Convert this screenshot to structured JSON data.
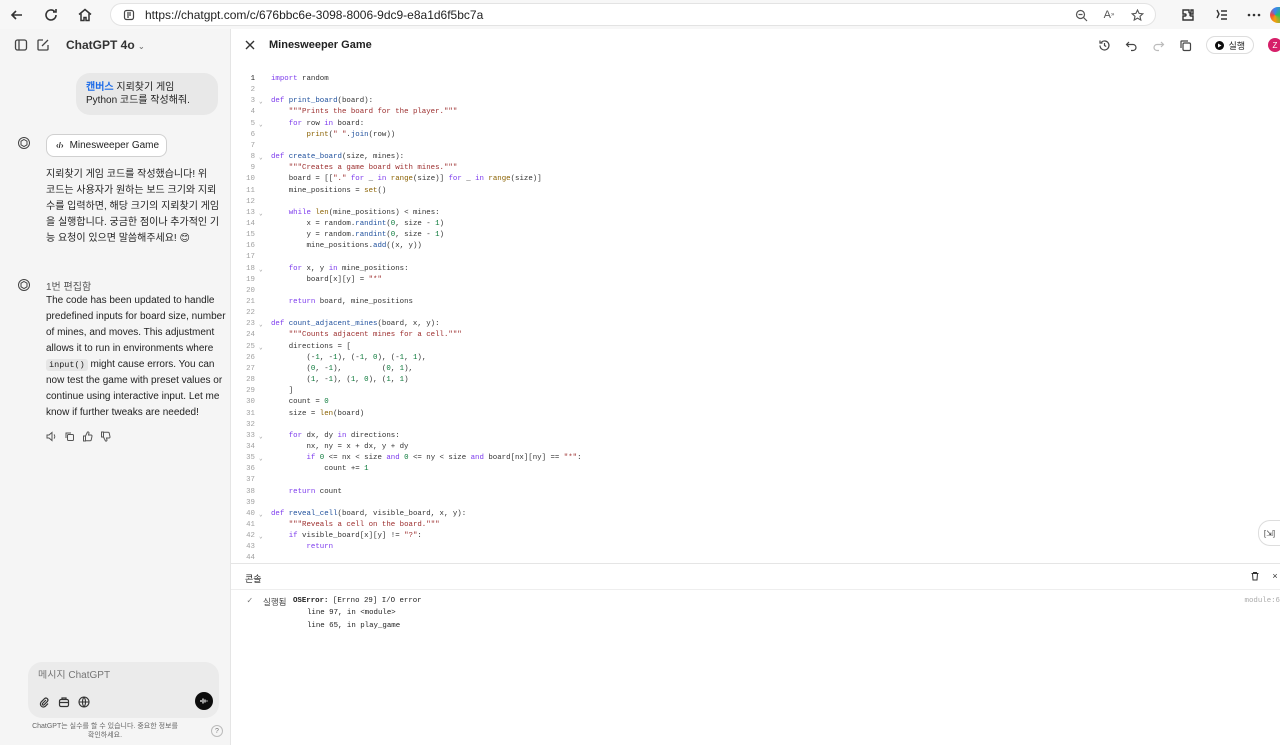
{
  "browser": {
    "url": "https://chatgpt.com/c/676bbc6e-3098-8006-9dc9-e8a1d6f5bc7a",
    "icons": [
      "back-icon",
      "reload-icon",
      "home-icon",
      "site-info-icon",
      "zoom-icon",
      "read-aloud-icon",
      "favorite-icon",
      "extensions-icon",
      "collections-icon",
      "more-icon"
    ]
  },
  "chat": {
    "model": "ChatGPT 4o",
    "user_prefix": "캔버스",
    "user_message": " 지뢰찾기 게임 Python 코드를 작성해줘.",
    "canvas_chip": "Minesweeper Game",
    "reply_lines": [
      "지뢰찾기 게임 코드를 작성했습니다! 위",
      "코드는 사용자가 원하는 보드 크기와 지뢰",
      "수를 입력하면, 해당 크기의 지뢰찾기 게임",
      "을 실행합니다. 궁금한 점이나 추가적인 기",
      "능 요청이 있으면 말씀해주세요! 😊"
    ],
    "edit_label": "1번 편집함",
    "update_lines_1": [
      "The code has been updated to handle",
      "predefined inputs for board size, number",
      "of mines, and moves. This adjustment",
      "allows it to run in environments where"
    ],
    "inline_code": "input()",
    "update_after_code": " might cause errors. You can",
    "update_lines_2": [
      "now test the game with preset values or",
      "continue using interactive input. Let me",
      "know if further tweaks are needed!"
    ],
    "composer_placeholder": "메시지 ChatGPT",
    "footer_line1": "ChatGPT는 실수를 할 수 있습니다. 중요한 정보를",
    "footer_line2": "확인하세요.",
    "help": "?"
  },
  "canvas": {
    "title": "Minesweeper Game",
    "run_label": "실행",
    "avatar_letter": "Z",
    "side_tab": "[⇲]",
    "code_lines": [
      {
        "n": "1",
        "t": "import random"
      },
      {
        "n": "2",
        "t": ""
      },
      {
        "n": "3",
        "t": "def print_board(board):",
        "fold": true
      },
      {
        "n": "4",
        "t": "    \"\"\"Prints the board for the player.\"\"\""
      },
      {
        "n": "5",
        "t": "    for row in board:",
        "fold": true
      },
      {
        "n": "6",
        "t": "        print(\" \".join(row))"
      },
      {
        "n": "7",
        "t": ""
      },
      {
        "n": "8",
        "t": "def create_board(size, mines):",
        "fold": true
      },
      {
        "n": "9",
        "t": "    \"\"\"Creates a game board with mines.\"\"\""
      },
      {
        "n": "10",
        "t": "    board = [[\".\" for _ in range(size)] for _ in range(size)]"
      },
      {
        "n": "11",
        "t": "    mine_positions = set()"
      },
      {
        "n": "12",
        "t": ""
      },
      {
        "n": "13",
        "t": "    while len(mine_positions) < mines:",
        "fold": true
      },
      {
        "n": "14",
        "t": "        x = random.randint(0, size - 1)"
      },
      {
        "n": "15",
        "t": "        y = random.randint(0, size - 1)"
      },
      {
        "n": "16",
        "t": "        mine_positions.add((x, y))"
      },
      {
        "n": "17",
        "t": ""
      },
      {
        "n": "18",
        "t": "    for x, y in mine_positions:",
        "fold": true
      },
      {
        "n": "19",
        "t": "        board[x][y] = \"*\""
      },
      {
        "n": "20",
        "t": ""
      },
      {
        "n": "21",
        "t": "    return board, mine_positions"
      },
      {
        "n": "22",
        "t": ""
      },
      {
        "n": "23",
        "t": "def count_adjacent_mines(board, x, y):",
        "fold": true
      },
      {
        "n": "24",
        "t": "    \"\"\"Counts adjacent mines for a cell.\"\"\""
      },
      {
        "n": "25",
        "t": "    directions = [",
        "fold": true
      },
      {
        "n": "26",
        "t": "        (-1, -1), (-1, 0), (-1, 1),"
      },
      {
        "n": "27",
        "t": "        (0, -1),         (0, 1),"
      },
      {
        "n": "28",
        "t": "        (1, -1), (1, 0), (1, 1)"
      },
      {
        "n": "29",
        "t": "    ]"
      },
      {
        "n": "30",
        "t": "    count = 0"
      },
      {
        "n": "31",
        "t": "    size = len(board)"
      },
      {
        "n": "32",
        "t": ""
      },
      {
        "n": "33",
        "t": "    for dx, dy in directions:",
        "fold": true
      },
      {
        "n": "34",
        "t": "        nx, ny = x + dx, y + dy"
      },
      {
        "n": "35",
        "t": "        if 0 <= nx < size and 0 <= ny < size and board[nx][ny] == \"*\":",
        "fold": true
      },
      {
        "n": "36",
        "t": "            count += 1"
      },
      {
        "n": "37",
        "t": ""
      },
      {
        "n": "38",
        "t": "    return count"
      },
      {
        "n": "39",
        "t": ""
      },
      {
        "n": "40",
        "t": "def reveal_cell(board, visible_board, x, y):",
        "fold": true
      },
      {
        "n": "41",
        "t": "    \"\"\"Reveals a cell on the board.\"\"\""
      },
      {
        "n": "42",
        "t": "    if visible_board[x][y] != \"?\":",
        "fold": true
      },
      {
        "n": "43",
        "t": "        return"
      },
      {
        "n": "44",
        "t": ""
      }
    ],
    "console": {
      "title": "콘솔",
      "status": "실행됨",
      "error_name": "OSError:",
      "error_msg": " [Errno 29] I/O error",
      "trace": [
        "line 97, in <module>",
        "line 65, in play_game"
      ],
      "module": "module:6"
    }
  }
}
